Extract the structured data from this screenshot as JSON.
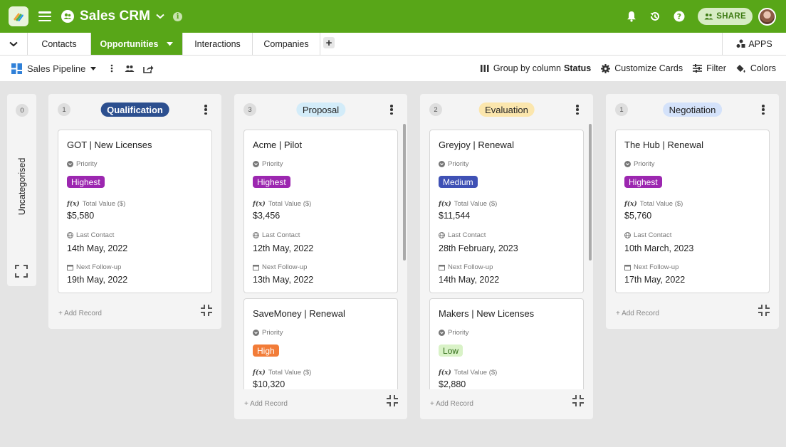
{
  "app": {
    "title": "Sales CRM",
    "share_label": "SHARE"
  },
  "tabs": [
    {
      "label": "Contacts",
      "active": false
    },
    {
      "label": "Opportunities",
      "active": true
    },
    {
      "label": "Interactions",
      "active": false
    },
    {
      "label": "Companies",
      "active": false
    }
  ],
  "apps_label": "APPS",
  "toolbar": {
    "view_name": "Sales Pipeline",
    "group_by_label": "Group by column",
    "group_by_field": "Status",
    "customize_label": "Customize Cards",
    "filter_label": "Filter",
    "colors_label": "Colors"
  },
  "uncategorised": {
    "label": "Uncategorised",
    "count": "0"
  },
  "field_labels": {
    "priority": "Priority",
    "total_value": "Total Value ($)",
    "last_contact": "Last Contact",
    "next_follow_up": "Next Follow-up"
  },
  "add_record_label": "+ Add Record",
  "columns": [
    {
      "status": "Qualification",
      "count": "1",
      "pill_bg": "#2c4f8f",
      "pill_fg": "#ffffff",
      "cards": [
        {
          "title": "GOT | New Licenses",
          "priority": "Highest",
          "priority_class": "highest",
          "total_value": "$5,580",
          "last_contact": "14th May, 2022",
          "next_follow_up": "19th May, 2022"
        }
      ]
    },
    {
      "status": "Proposal",
      "count": "3",
      "pill_bg": "#d3ecf9",
      "pill_fg": "#222222",
      "cards": [
        {
          "title": "Acme | Pilot",
          "priority": "Highest",
          "priority_class": "highest",
          "total_value": "$3,456",
          "last_contact": "12th May, 2022",
          "next_follow_up": "13th May, 2022"
        },
        {
          "title": "SaveMoney | Renewal",
          "priority": "High",
          "priority_class": "high",
          "total_value": "$10,320",
          "last_contact": "",
          "next_follow_up": ""
        }
      ]
    },
    {
      "status": "Evaluation",
      "count": "2",
      "pill_bg": "#fbe6ad",
      "pill_fg": "#222222",
      "cards": [
        {
          "title": "Greyjoy | Renewal",
          "priority": "Medium",
          "priority_class": "medium",
          "total_value": "$11,544",
          "last_contact": "28th February, 2023",
          "next_follow_up": "14th May, 2022"
        },
        {
          "title": "Makers | New Licenses",
          "priority": "Low",
          "priority_class": "low",
          "total_value": "$2,880",
          "last_contact": "",
          "next_follow_up": ""
        }
      ]
    },
    {
      "status": "Negotiation",
      "count": "1",
      "pill_bg": "#d4e2fa",
      "pill_fg": "#222222",
      "cards": [
        {
          "title": "The Hub | Renewal",
          "priority": "Highest",
          "priority_class": "highest",
          "total_value": "$5,760",
          "last_contact": "10th March, 2023",
          "next_follow_up": "17th May, 2022"
        }
      ]
    }
  ],
  "colors": {
    "brand": "#58a618",
    "highest": "#9c27b0",
    "medium": "#3f51b5",
    "high": "#f27c38",
    "low": "#d9f2c7"
  }
}
